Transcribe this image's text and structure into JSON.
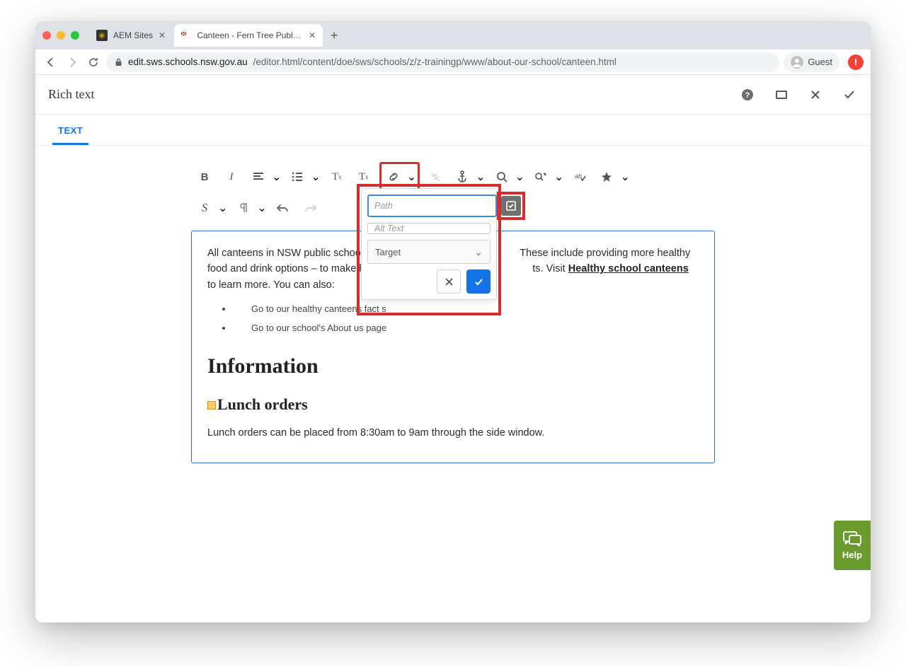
{
  "browser": {
    "tabs": [
      {
        "title": "AEM Sites",
        "active": false
      },
      {
        "title": "Canteen - Fern Tree Public Sch",
        "active": true
      }
    ],
    "url_host": "edit.sws.schools.nsw.gov.au",
    "url_path": "/editor.html/content/doe/sws/schools/z/z-trainingp/www/about-our-school/canteen.html",
    "guest_label": "Guest"
  },
  "header": {
    "title": "Rich text",
    "tab_label": "TEXT"
  },
  "link_popover": {
    "path_placeholder": "Path",
    "alt_placeholder": "Alt Text",
    "target_label": "Target"
  },
  "content": {
    "para1_a": "All canteens in NSW public schools m",
    "para1_b": "These include providing more healthy food and drink options – to make healthy",
    "para1_c": "ts. Visit ",
    "para1_link": "Healthy school canteens",
    "para1_d": " to learn more. You can also:",
    "bullet1": "Go to our healthy canteens fact s",
    "bullet2": "Go to our school's About us page",
    "h2": "Information",
    "h3": "Lunch orders",
    "para2": "Lunch orders can be placed from 8:30am to 9am through the side window."
  },
  "help": {
    "label": "Help"
  }
}
